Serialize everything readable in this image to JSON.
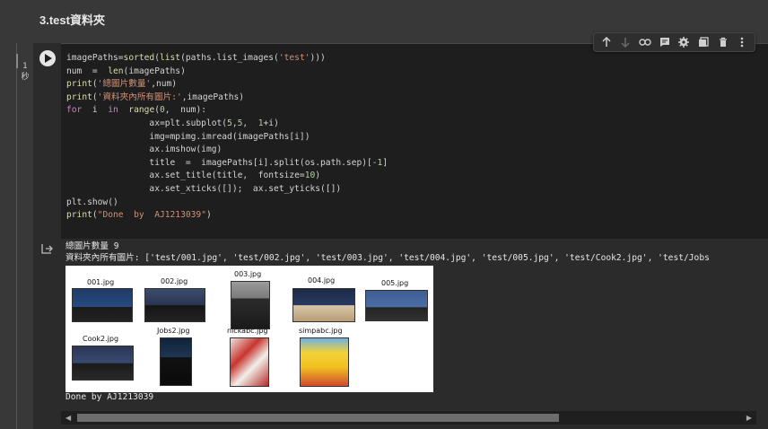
{
  "section": {
    "heading": "3.test資料夾"
  },
  "cell": {
    "exec_time_value": "1",
    "exec_time_unit": "秒",
    "toolbar": {
      "move_up": "arrow-up-icon",
      "move_down": "arrow-down-icon",
      "link": "link-icon",
      "comment": "comment-icon",
      "settings": "gear-icon",
      "mirror": "mirror-cell-icon",
      "delete": "trash-icon",
      "more": "more-vert-icon"
    },
    "code_lines": [
      "imagePaths=sorted(list(paths.list_images('test')))",
      "num  =  len(imagePaths)",
      "print('總圖片數量',num)",
      "print('資料夾內所有圖片:',imagePaths)",
      "for  i  in  range(0,  num):",
      "                ax=plt.subplot(5,5,  1+i)",
      "                img=mpimg.imread(imagePaths[i])",
      "                ax.imshow(img)",
      "                title  =  imagePaths[i].split(os.path.sep)[-1]",
      "                ax.set_title(title,  fontsize=10)",
      "                ax.set_xticks([]);  ax.set_yticks([])",
      "plt.show()",
      "print(\"Done  by  AJ1213039\")"
    ]
  },
  "output": {
    "line1": "總圖片數量 9",
    "line2": "資料夾內所有圖片: ['test/001.jpg', 'test/002.jpg', 'test/003.jpg', 'test/004.jpg', 'test/005.jpg', 'test/Cook2.jpg', 'test/Jobs",
    "images": [
      {
        "title": "001.jpg"
      },
      {
        "title": "002.jpg"
      },
      {
        "title": "003.jpg"
      },
      {
        "title": "004.jpg"
      },
      {
        "title": "005.jpg"
      },
      {
        "title": "Cook2.jpg"
      },
      {
        "title": "Jobs2.jpg"
      },
      {
        "title": "nickabc.jpg"
      },
      {
        "title": "simpabc.jpg"
      }
    ],
    "done": "Done by AJ1213039"
  }
}
